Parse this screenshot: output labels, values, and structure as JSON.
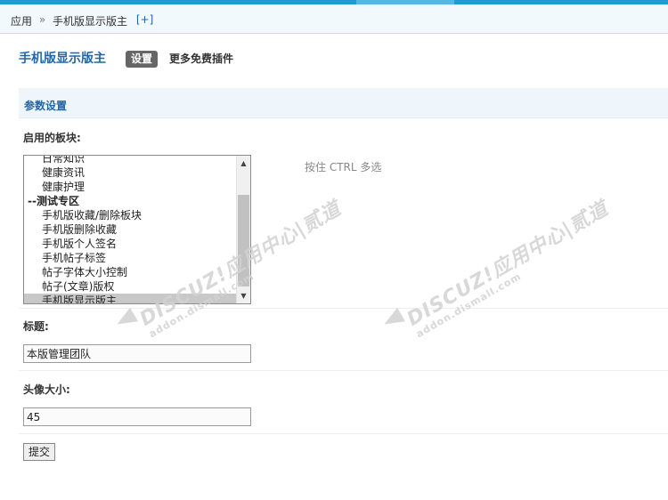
{
  "breadcrumb": {
    "root": "应用",
    "separator": "»",
    "current": "手机版显示版主",
    "add_label": "[+]"
  },
  "header": {
    "title": "手机版显示版主",
    "tab_settings": "设置",
    "tab_more_plugins": "更多免费插件"
  },
  "section": {
    "title": "参数设置"
  },
  "forums_field": {
    "label": "启用的板块:",
    "hint": "按住 CTRL 多选",
    "options": [
      {
        "label": "日常知识",
        "kind": "item",
        "selected": false
      },
      {
        "label": "健康资讯",
        "kind": "item",
        "selected": false
      },
      {
        "label": "健康护理",
        "kind": "item",
        "selected": false
      },
      {
        "label": "--测试专区",
        "kind": "group",
        "selected": false
      },
      {
        "label": "手机版收藏/删除板块",
        "kind": "item",
        "selected": false
      },
      {
        "label": "手机版删除收藏",
        "kind": "item",
        "selected": false
      },
      {
        "label": "手机版个人签名",
        "kind": "item",
        "selected": false
      },
      {
        "label": "手机帖子标签",
        "kind": "item",
        "selected": false
      },
      {
        "label": "帖子字体大小控制",
        "kind": "item",
        "selected": false
      },
      {
        "label": "帖子(文章)版权",
        "kind": "item",
        "selected": false
      },
      {
        "label": "手机版显示版主",
        "kind": "item",
        "selected": true
      }
    ]
  },
  "title_field": {
    "label": "标题:",
    "value": "本版管理团队"
  },
  "avatar_field": {
    "label": "头像大小:",
    "value": "45"
  },
  "submit_label": "提交",
  "watermark": {
    "brand": "DISCUZ!应用中心",
    "site": "addon.dismall.com",
    "logo_text": "|贰道"
  },
  "colors": {
    "accent": "#1e9bd3",
    "link": "#2366a8",
    "section_bg": "#eef6fb"
  }
}
